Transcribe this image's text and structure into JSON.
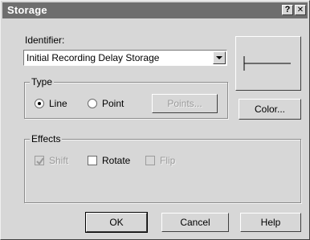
{
  "window": {
    "title": "Storage",
    "help_glyph": "?",
    "close_glyph": "✕"
  },
  "identifier": {
    "label": "Identifier:",
    "value": "Initial Recording Delay Storage"
  },
  "type_group": {
    "label": "Type",
    "options": [
      {
        "label": "Line",
        "selected": true
      },
      {
        "label": "Point",
        "selected": false
      }
    ],
    "points_button": "Points...",
    "points_enabled": false
  },
  "color_button": "Color...",
  "effects_group": {
    "label": "Effects",
    "options": [
      {
        "label": "Shift",
        "checked": true,
        "enabled": false
      },
      {
        "label": "Rotate",
        "checked": false,
        "enabled": true
      },
      {
        "label": "Flip",
        "checked": false,
        "enabled": false
      }
    ]
  },
  "buttons": {
    "ok": "OK",
    "cancel": "Cancel",
    "help": "Help"
  }
}
